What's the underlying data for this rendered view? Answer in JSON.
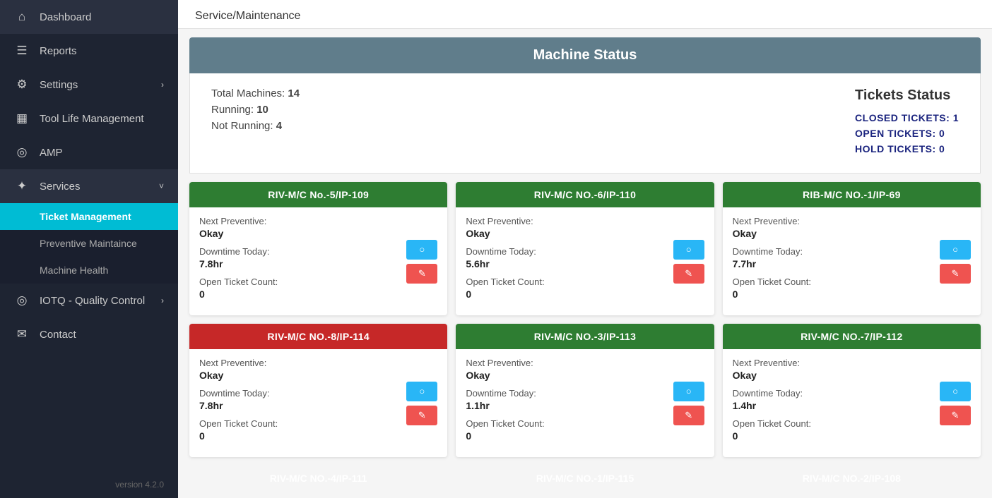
{
  "sidebar": {
    "items": [
      {
        "label": "Dashboard",
        "icon": "⌂",
        "active": false,
        "hasChevron": false
      },
      {
        "label": "Reports",
        "icon": "☰",
        "active": false,
        "hasChevron": false
      },
      {
        "label": "Settings",
        "icon": "⚙",
        "active": false,
        "hasChevron": true
      },
      {
        "label": "Tool Life Management",
        "icon": "▦",
        "active": false,
        "hasChevron": false
      },
      {
        "label": "AMP",
        "icon": "◎",
        "active": false,
        "hasChevron": false
      },
      {
        "label": "Services",
        "icon": "✦",
        "active": true,
        "hasChevron": true
      }
    ],
    "subitems": [
      {
        "label": "Ticket Management",
        "active": true
      },
      {
        "label": "Preventive Maintaince",
        "active": false
      },
      {
        "label": "Machine Health",
        "active": false
      }
    ],
    "extra_items": [
      {
        "label": "IOTQ - Quality Control",
        "icon": "◎",
        "hasChevron": true
      },
      {
        "label": "Contact",
        "icon": "✉",
        "hasChevron": false
      }
    ],
    "version": "version 4.2.0"
  },
  "breadcrumb": "Service/Maintenance",
  "machine_status": {
    "header": "Machine Status",
    "total_machines_label": "Total Machines:",
    "total_machines_value": "14",
    "running_label": "Running:",
    "running_value": "10",
    "not_running_label": "Not Running:",
    "not_running_value": "4",
    "tickets": {
      "title": "Tickets Status",
      "closed_label": "CLOSED TICKETS:",
      "closed_value": "1",
      "open_label": "OPEN TICKETS:",
      "open_value": "0",
      "hold_label": "HOLD TICKETS:",
      "hold_value": "0"
    }
  },
  "cards": [
    {
      "id": "card-1",
      "name": "RIV-M/C No.-5/IP-109",
      "color": "green",
      "next_preventive_label": "Next Preventive:",
      "next_preventive_value": "Okay",
      "downtime_label": "Downtime Today:",
      "downtime_value": "7.8hr",
      "ticket_count_label": "Open Ticket Count:",
      "ticket_count_value": "0"
    },
    {
      "id": "card-2",
      "name": "RIV-M/C NO.-6/IP-110",
      "color": "green",
      "next_preventive_label": "Next Preventive:",
      "next_preventive_value": "Okay",
      "downtime_label": "Downtime Today:",
      "downtime_value": "5.6hr",
      "ticket_count_label": "Open Ticket Count:",
      "ticket_count_value": "0"
    },
    {
      "id": "card-3",
      "name": "RIB-M/C NO.-1/IP-69",
      "color": "green",
      "next_preventive_label": "Next Preventive:",
      "next_preventive_value": "Okay",
      "downtime_label": "Downtime Today:",
      "downtime_value": "7.7hr",
      "ticket_count_label": "Open Ticket Count:",
      "ticket_count_value": "0"
    },
    {
      "id": "card-4",
      "name": "RIV-M/C NO.-8/IP-114",
      "color": "red",
      "next_preventive_label": "Next Preventive:",
      "next_preventive_value": "Okay",
      "downtime_label": "Downtime Today:",
      "downtime_value": "7.8hr",
      "ticket_count_label": "Open Ticket Count:",
      "ticket_count_value": "0"
    },
    {
      "id": "card-5",
      "name": "RIV-M/C NO.-3/IP-113",
      "color": "green",
      "next_preventive_label": "Next Preventive:",
      "next_preventive_value": "Okay",
      "downtime_label": "Downtime Today:",
      "downtime_value": "1.1hr",
      "ticket_count_label": "Open Ticket Count:",
      "ticket_count_value": "0"
    },
    {
      "id": "card-6",
      "name": "RIV-M/C NO.-7/IP-112",
      "color": "green",
      "next_preventive_label": "Next Preventive:",
      "next_preventive_value": "Okay",
      "downtime_label": "Downtime Today:",
      "downtime_value": "1.4hr",
      "ticket_count_label": "Open Ticket Count:",
      "ticket_count_value": "0"
    }
  ],
  "bottom_cards": [
    {
      "id": "bc-1",
      "name": "RIV-M/C NO.-4/IP-111",
      "color": "green"
    },
    {
      "id": "bc-2",
      "name": "RIV-M/C NO.-1/IP-115",
      "color": "red"
    },
    {
      "id": "bc-3",
      "name": "RIV-M/C NO.-2/IP-108",
      "color": "red"
    }
  ]
}
